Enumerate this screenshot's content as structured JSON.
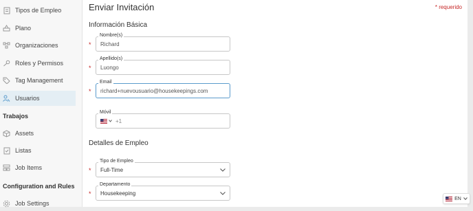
{
  "sidebar": {
    "items_top": [
      {
        "label": "Tipos de Empleo",
        "icon": "document-icon"
      },
      {
        "label": "Plano",
        "icon": "floorplan-icon"
      },
      {
        "label": "Organizaciones",
        "icon": "org-icon"
      },
      {
        "label": "Roles y Permisos",
        "icon": "key-icon"
      },
      {
        "label": "Tag Management",
        "icon": "tag-icon"
      },
      {
        "label": "Usuarios",
        "icon": "users-icon",
        "active": true
      }
    ],
    "section_trabajos": "Trabajos",
    "items_trabajos": [
      {
        "label": "Assets",
        "icon": "cube-icon"
      },
      {
        "label": "Listas",
        "icon": "checklist-icon"
      },
      {
        "label": "Job Items",
        "icon": "job-items-icon"
      }
    ],
    "section_config": "Configuration and Rules",
    "items_config": [
      {
        "label": "Job Settings",
        "icon": "gear-icon"
      }
    ]
  },
  "main": {
    "title": "Enviar Invitación",
    "required_note": "* requerido",
    "section_basic": "Información Básica",
    "nombre_label": "Nombre(s)",
    "nombre_value": "Richard",
    "apellido_label": "Apellido(s)",
    "apellido_value": "Luongo",
    "email_label": "Email",
    "email_value": "richard+nuevousuario@housekeepings.com",
    "movil_label": "Móvil",
    "movil_placeholder": "+1",
    "section_employment": "Detalles de Empleo",
    "tipo_label": "Tipo de Empleo",
    "tipo_value": "Full-Time",
    "departamento_label": "Departamento",
    "departamento_value": "Housekeeping",
    "asterisk": "*"
  },
  "language": {
    "label": "EN"
  },
  "colors": {
    "accent": "#5a9bcc",
    "required": "#c62828",
    "active_bg": "#e4eef4"
  }
}
